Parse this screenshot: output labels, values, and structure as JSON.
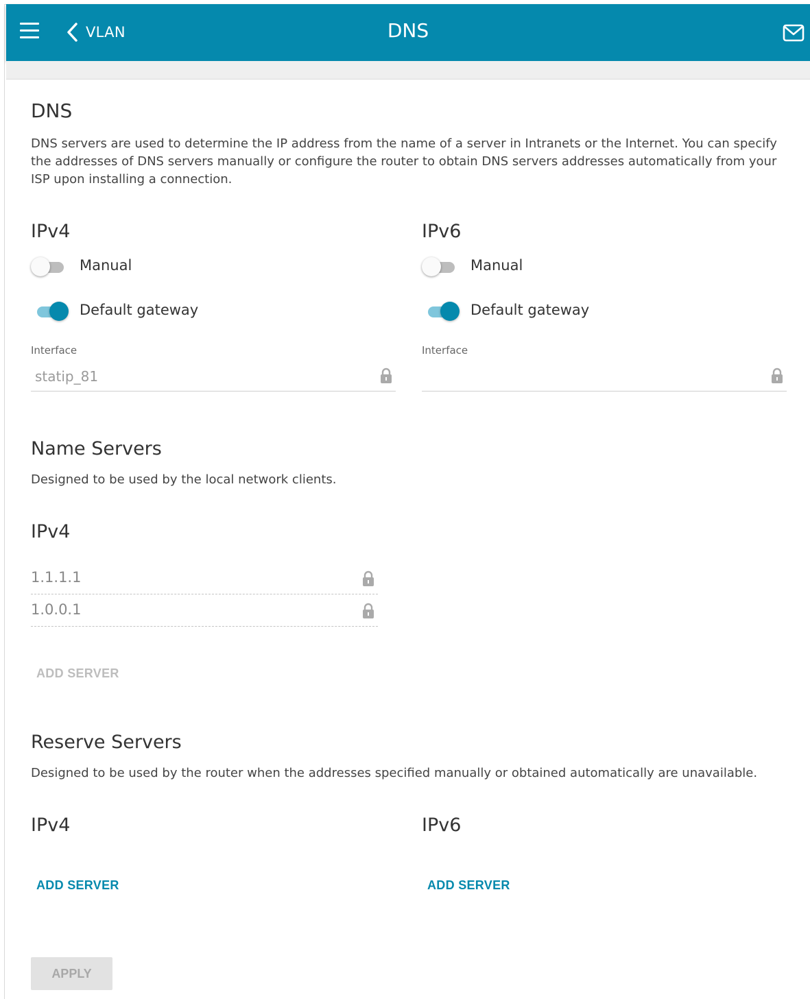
{
  "header": {
    "back_label": "VLAN",
    "title": "DNS",
    "accent": "#0589ad"
  },
  "dns": {
    "title": "DNS",
    "description": "DNS servers are used to determine the IP address from the name of a server in Intranets or the Internet. You can specify the addresses of DNS servers manually or configure the router to obtain DNS servers addresses automatically from your ISP upon installing a connection.",
    "ipv4": {
      "heading": "IPv4",
      "manual_label": "Manual",
      "manual_on": false,
      "gateway_label": "Default gateway",
      "gateway_on": true,
      "interface_label": "Interface",
      "interface_value": "statip_81"
    },
    "ipv6": {
      "heading": "IPv6",
      "manual_label": "Manual",
      "manual_on": false,
      "gateway_label": "Default gateway",
      "gateway_on": true,
      "interface_label": "Interface",
      "interface_value": ""
    }
  },
  "name_servers": {
    "title": "Name Servers",
    "description": "Designed to be used by the local network clients.",
    "ipv4_heading": "IPv4",
    "servers": [
      "1.1.1.1",
      "1.0.0.1"
    ],
    "add_label": "ADD SERVER"
  },
  "reserve_servers": {
    "title": "Reserve Servers",
    "description": "Designed to be used by the router when the addresses specified manually or obtained automatically are unavailable.",
    "ipv4_heading": "IPv4",
    "ipv6_heading": "IPv6",
    "add_ipv4_label": "ADD SERVER",
    "add_ipv6_label": "ADD SERVER"
  },
  "apply_label": "APPLY"
}
